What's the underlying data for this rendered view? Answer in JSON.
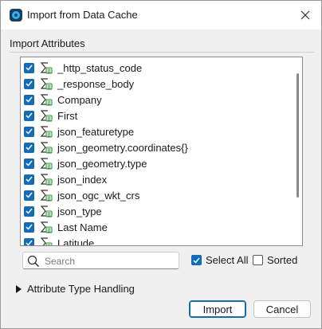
{
  "window": {
    "title": "Import from Data Cache"
  },
  "group": {
    "label": "Import Attributes"
  },
  "attributes": [
    {
      "label": "_http_status_code",
      "checked": true
    },
    {
      "label": "_response_body",
      "checked": true
    },
    {
      "label": "Company",
      "checked": true
    },
    {
      "label": "First",
      "checked": true
    },
    {
      "label": "json_featuretype",
      "checked": true
    },
    {
      "label": "json_geometry.coordinates{}",
      "checked": true
    },
    {
      "label": "json_geometry.type",
      "checked": true
    },
    {
      "label": "json_index",
      "checked": true
    },
    {
      "label": "json_ogc_wkt_crs",
      "checked": true
    },
    {
      "label": "json_type",
      "checked": true
    },
    {
      "label": "Last Name",
      "checked": true
    },
    {
      "label": "Latitude",
      "checked": true
    }
  ],
  "search": {
    "placeholder": "Search",
    "value": ""
  },
  "options": {
    "select_all_label": "Select All",
    "select_all_checked": true,
    "sorted_label": "Sorted",
    "sorted_checked": false
  },
  "section": {
    "label": "Attribute Type Handling",
    "expanded": false
  },
  "buttons": {
    "import_label": "Import",
    "cancel_label": "Cancel"
  },
  "colors": {
    "accent": "#0f6cbd",
    "attr_icon": "#2e8b3a"
  },
  "icons": {
    "app": "data-cache-icon",
    "close": "close-icon",
    "attribute": "attribute-type-icon",
    "search": "search-icon",
    "expand": "triangle-right-icon"
  }
}
